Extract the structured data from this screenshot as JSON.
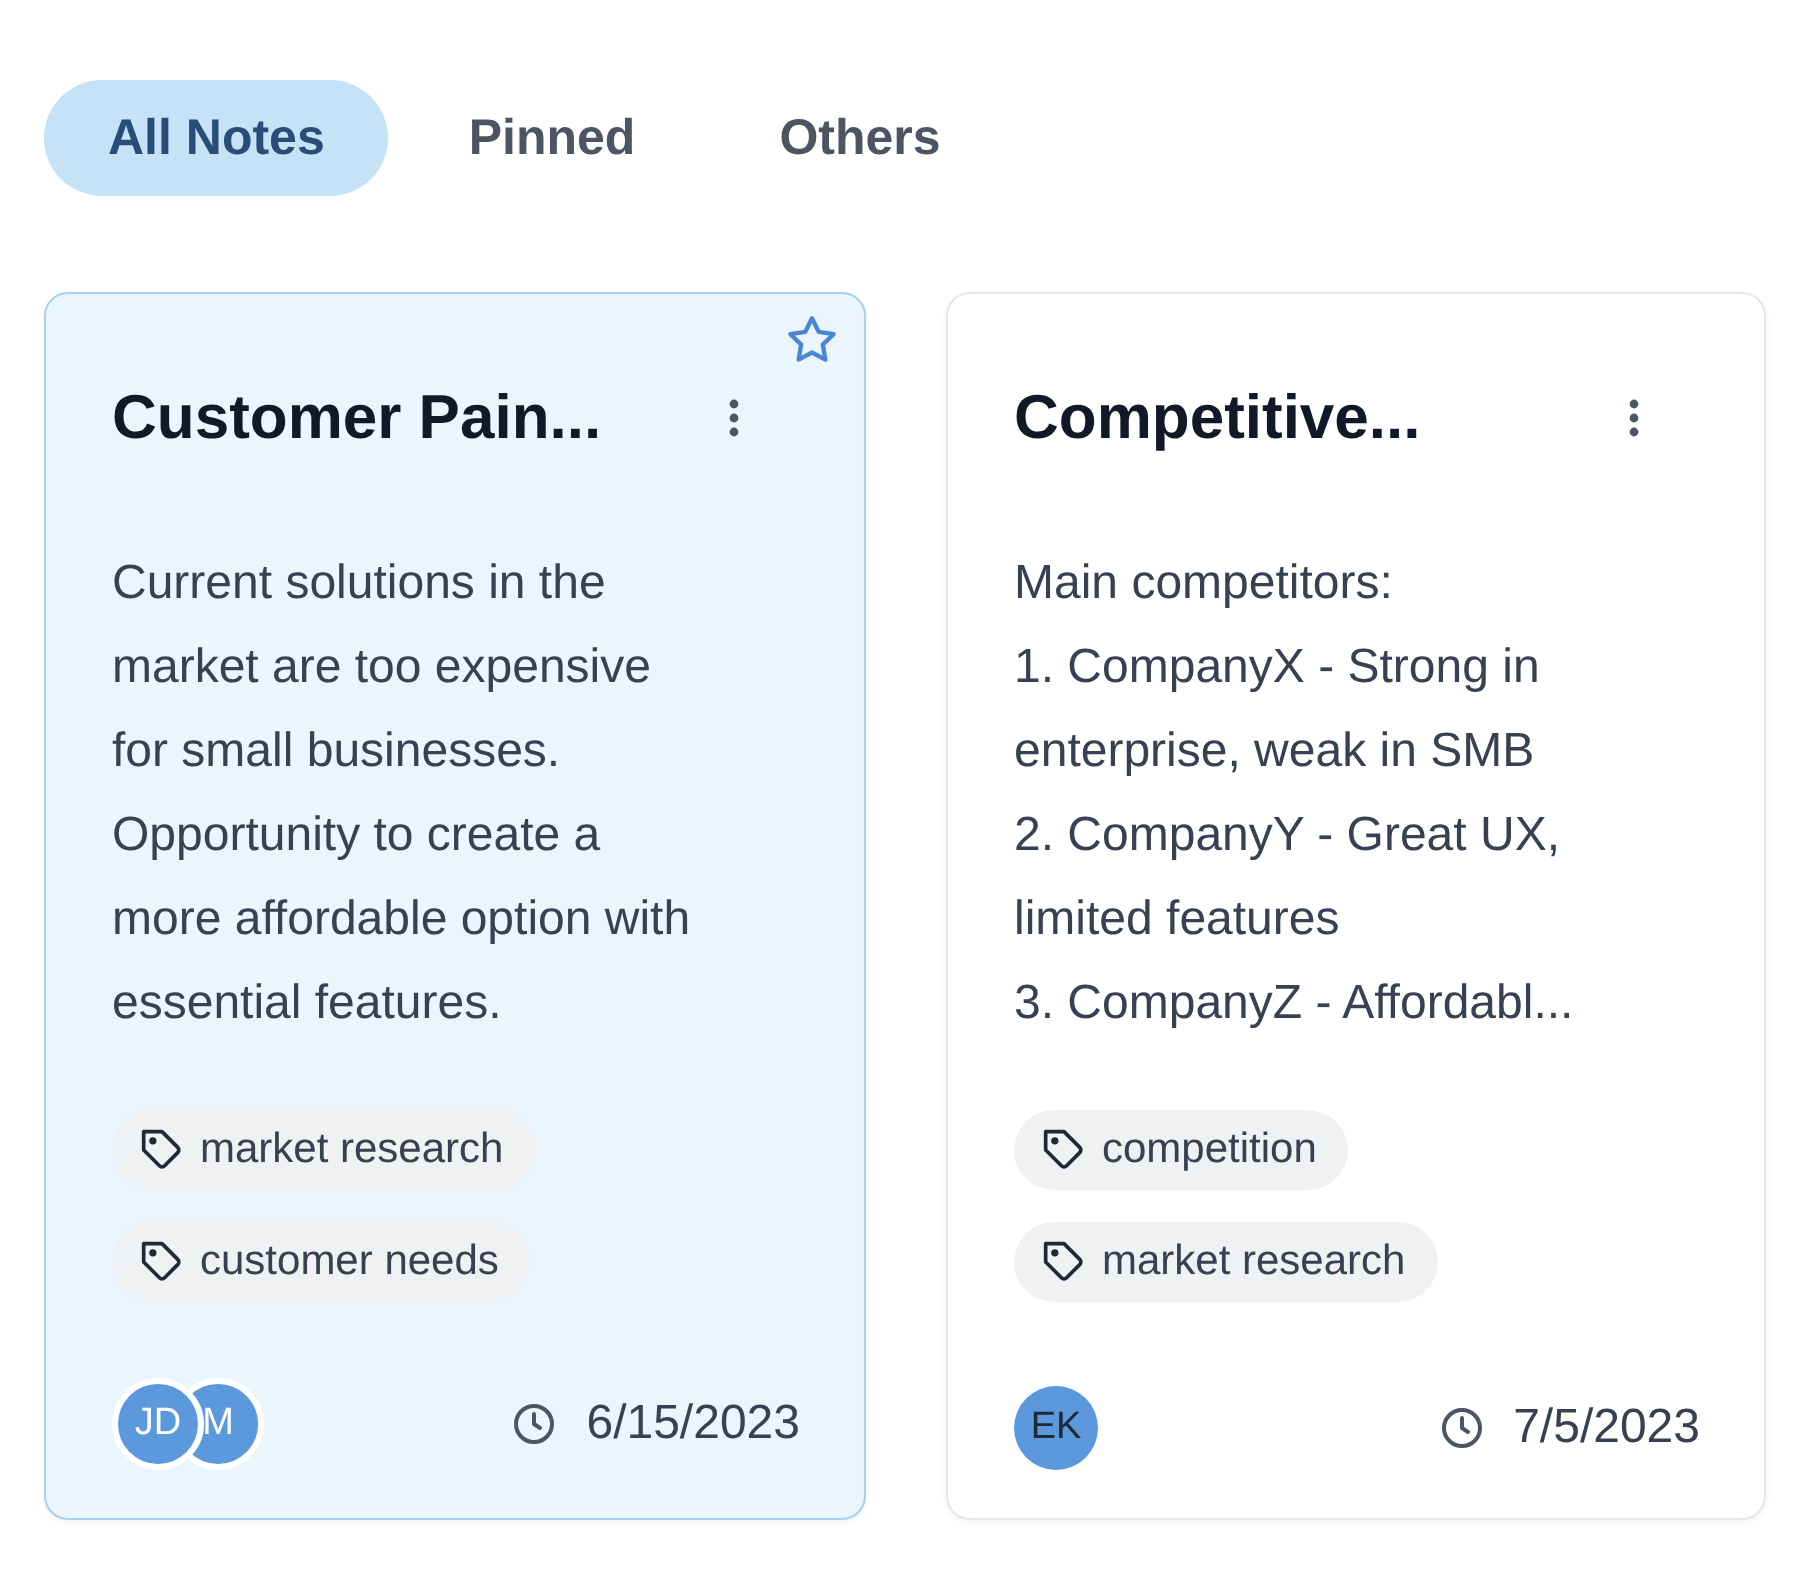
{
  "tabs": [
    {
      "label": "All Notes",
      "selected": true
    },
    {
      "label": "Pinned",
      "selected": false
    },
    {
      "label": "Others",
      "selected": false
    }
  ],
  "notes": [
    {
      "title": "Customer Pain...",
      "selected": true,
      "pinned": true,
      "lines": [
        "Current solutions in the",
        "market are too expensive",
        "for small businesses.",
        "Opportunity to create a",
        "more affordable option with",
        "essential features."
      ],
      "tags": [
        "market research",
        "customer needs"
      ],
      "avatars": [
        {
          "initials": "JD",
          "outlined": true
        },
        {
          "initials": "M",
          "outlined": true
        }
      ],
      "date": "6/15/2023"
    },
    {
      "title": "Competitive...",
      "selected": false,
      "pinned": false,
      "lines": [
        "Main competitors:",
        "1. CompanyX - Strong in",
        "enterprise, weak in SMB",
        "2. CompanyY - Great UX,",
        "limited features",
        "3. CompanyZ - Affordabl..."
      ],
      "tags": [
        "competition",
        "market research"
      ],
      "avatars": [
        {
          "initials": "EK",
          "outlined": false
        }
      ],
      "date": "7/5/2023"
    }
  ]
}
